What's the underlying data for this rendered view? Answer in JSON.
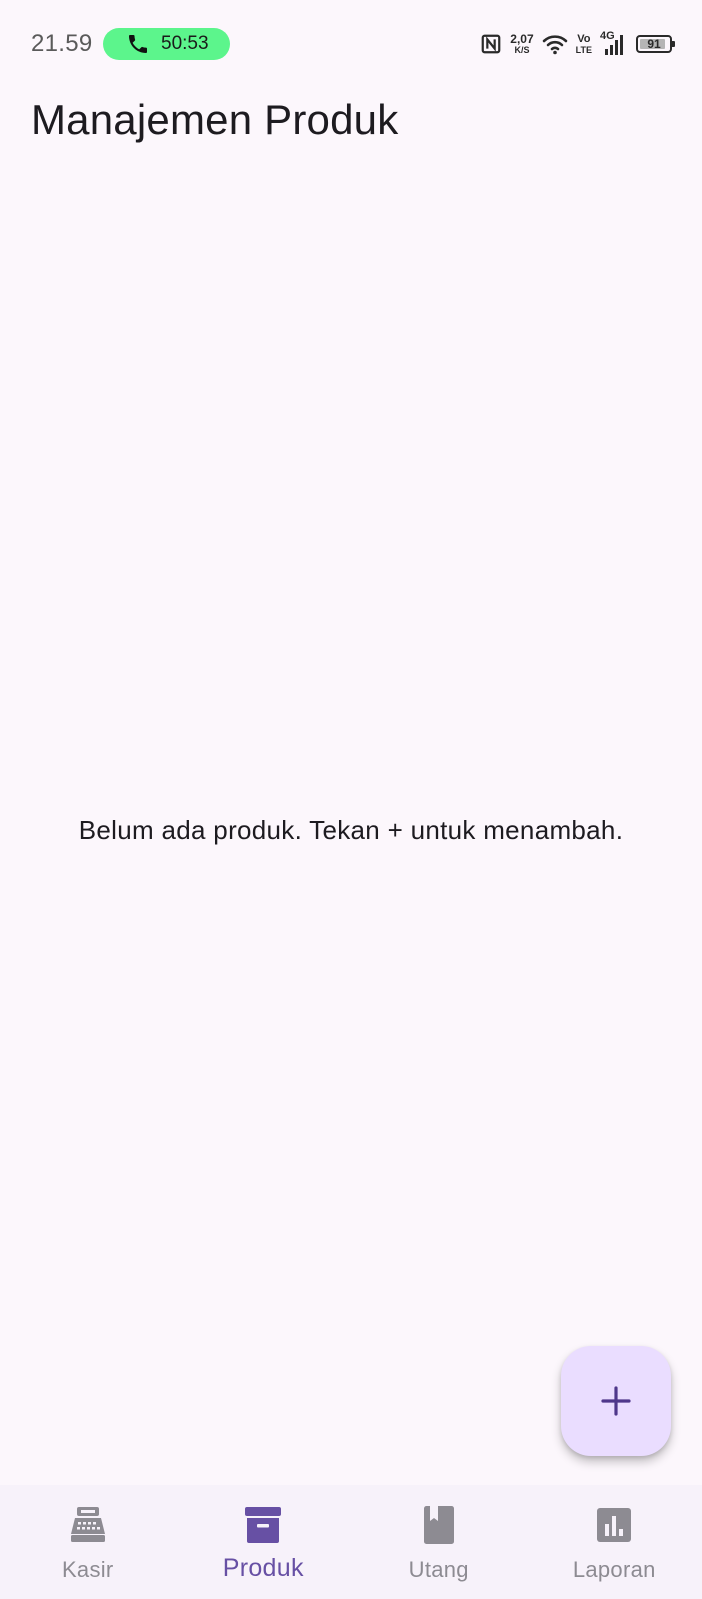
{
  "status_bar": {
    "time": "21.59",
    "call_timer": "50:53",
    "net_speed": "2,07",
    "net_speed_unit": "K/S",
    "volte_top": "Vo",
    "volte_bottom": "LTE",
    "network_type": "4G",
    "battery_level": "91"
  },
  "app_bar": {
    "title": "Manajemen Produk"
  },
  "main": {
    "empty_message": "Belum ada produk. Tekan + untuk menambah."
  },
  "fab": {
    "icon": "plus-icon",
    "color": "#eaddff",
    "icon_color": "#4f378b"
  },
  "bottom_nav": {
    "active_index": 1,
    "active_color": "#6750a4",
    "inactive_color": "#8d8b92",
    "items": [
      {
        "label": "Kasir",
        "icon": "cash-register-icon"
      },
      {
        "label": "Produk",
        "icon": "inventory-box-icon"
      },
      {
        "label": "Utang",
        "icon": "book-icon"
      },
      {
        "label": "Laporan",
        "icon": "bar-chart-icon"
      }
    ]
  }
}
